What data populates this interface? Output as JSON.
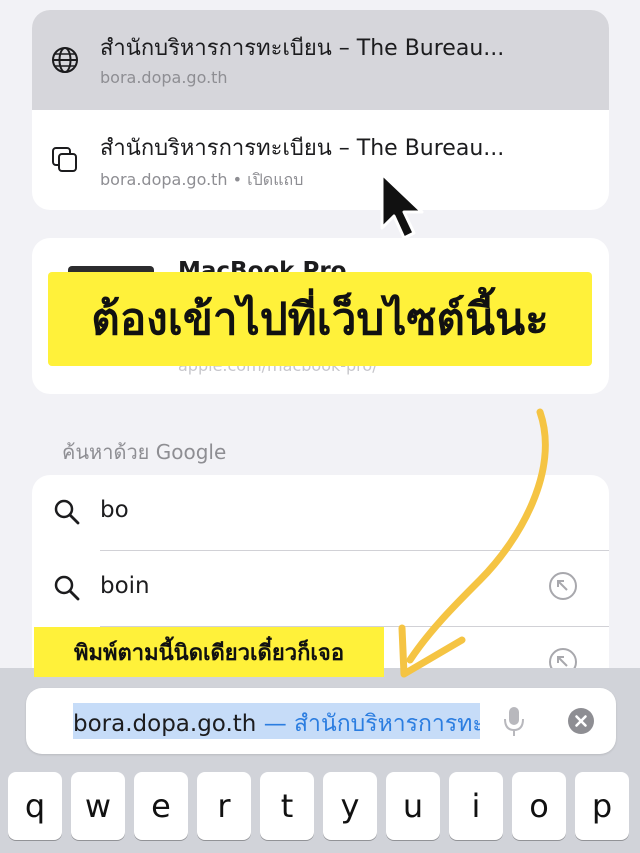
{
  "top_results": [
    {
      "title": "สำนักบริหารการทะเบียน – The Bureau...",
      "subtitle": "bora.dopa.go.th",
      "icon": "globe-icon"
    },
    {
      "title": "สำนักบริหารการทะเบียน – The Bureau...",
      "subtitle": "bora.dopa.go.th • เปิดแถบ",
      "icon": "tabs-icon"
    }
  ],
  "macbook_result": {
    "title": "MacBook Pro",
    "subtitle": "apple.com/macbook-pro/"
  },
  "overlay_banner": "ต้องเข้าไปที่เว็บไซต์นี้นะ",
  "search_section_label": "ค้นหาด้วย Google",
  "suggestions": [
    {
      "text": "bo"
    },
    {
      "text": "boin"
    }
  ],
  "overlay_small_banner": "พิมพ์ตามนี้นิดเดียวเดี๋ยวก็เจอ",
  "address_bar": {
    "url": "bora.dopa.go.th",
    "title_suffix": " — สำนักบริหารการทะเบ"
  },
  "keyboard": {
    "row1": [
      "q",
      "w",
      "e",
      "r",
      "t",
      "y",
      "u",
      "i",
      "o",
      "p"
    ]
  },
  "colors": {
    "highlight": "#fff13a",
    "selection": "#c6dcf8",
    "link": "#2b7de0",
    "arrow": "#f5c443"
  }
}
